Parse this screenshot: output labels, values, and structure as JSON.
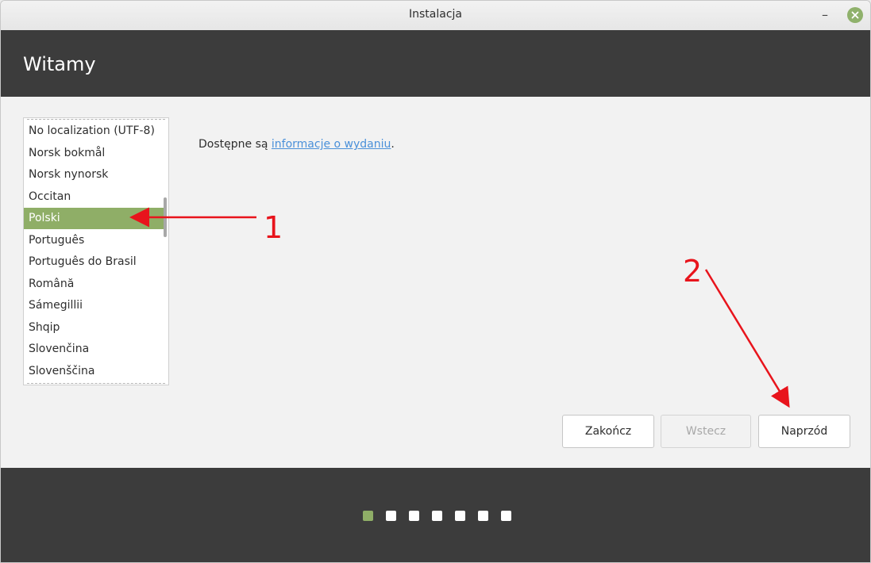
{
  "window": {
    "title": "Instalacja",
    "minimize_label": "–"
  },
  "header": {
    "title": "Witamy"
  },
  "language_list": {
    "items": [
      {
        "label": "No localization (UTF-8)"
      },
      {
        "label": "Norsk bokmål"
      },
      {
        "label": "Norsk nynorsk"
      },
      {
        "label": "Occitan"
      },
      {
        "label": "Polski",
        "selected": true
      },
      {
        "label": "Português"
      },
      {
        "label": "Português do Brasil"
      },
      {
        "label": "Română"
      },
      {
        "label": "Sámegillii"
      },
      {
        "label": "Shqip"
      },
      {
        "label": "Slovenčina"
      },
      {
        "label": "Slovenščina"
      }
    ]
  },
  "release": {
    "prefix": "Dostępne są ",
    "link": "informacje o wydaniu",
    "suffix": "."
  },
  "buttons": {
    "quit": "Zakończ",
    "back": "Wstecz",
    "forward": "Naprzód"
  },
  "progress": {
    "total_steps": 7,
    "current_step": 1
  },
  "annotations": {
    "label_1": "1",
    "label_2": "2",
    "arrow_color": "#e8141c"
  },
  "colors": {
    "accent": "#8fae67",
    "header_bg": "#3c3c3c",
    "link": "#4a90d9"
  }
}
